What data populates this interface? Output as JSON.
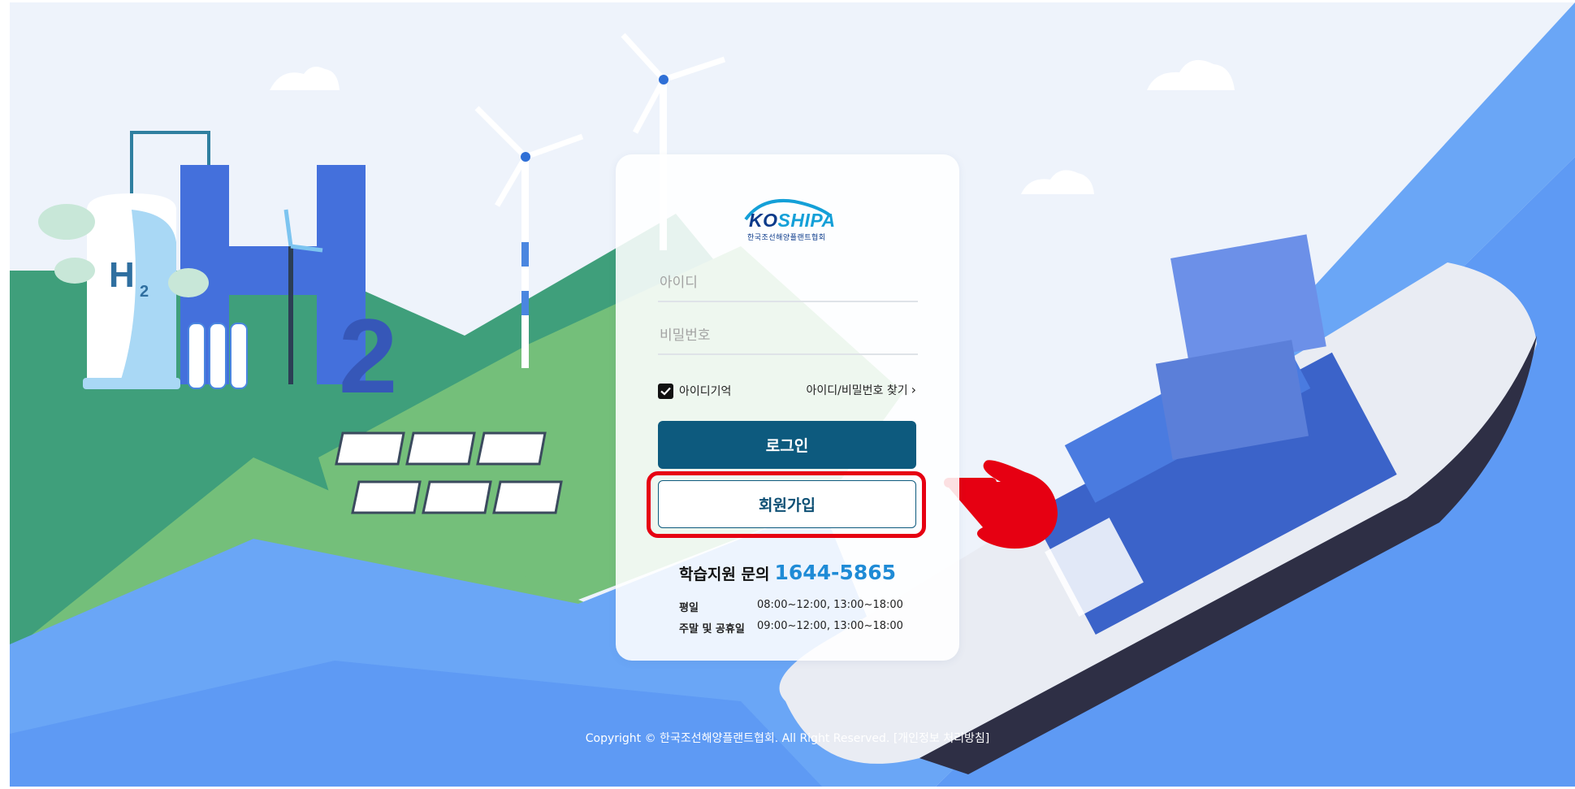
{
  "colors": {
    "sky": "#eef3fb",
    "sea": "#5e9af4",
    "hill_dark": "#3f9f7b",
    "hill_light": "#74bf7a",
    "accent_blue": "#1f8bd6",
    "login_button": "#0d5a7e",
    "highlight_red": "#e60012"
  },
  "logo": {
    "brand_ko": "KO",
    "brand_rest": "SHIPA",
    "subtitle": "한국조선해양플랜트협회"
  },
  "login": {
    "id_placeholder": "아이디",
    "password_placeholder": "비밀번호",
    "remember_label": "아이디기억",
    "remember_checked": true,
    "find_link": "아이디/비밀번호 찾기",
    "login_button": "로그인",
    "join_button": "회원가입"
  },
  "support": {
    "label": "학습지원 문의",
    "phone": "1644-5865",
    "hours": [
      {
        "day": "평일",
        "time": "08:00~12:00, 13:00~18:00"
      },
      {
        "day": "주말 및 공휴일",
        "time": "09:00~12:00, 13:00~18:00"
      }
    ]
  },
  "footer": {
    "copyright": "Copyright © 한국조선해양플랜트협회. All Right Reserved.",
    "privacy_link": "[개인정보 처리방침]"
  },
  "illustration": {
    "h2_label": "H",
    "h2_sub": "2",
    "big_two": "2"
  },
  "icons": [
    "check-icon",
    "chevron-right-icon",
    "pointing-hand-icon",
    "wind-turbine-icon",
    "solar-panel-icon",
    "cargo-ship-icon",
    "hydrogen-tank-icon"
  ]
}
